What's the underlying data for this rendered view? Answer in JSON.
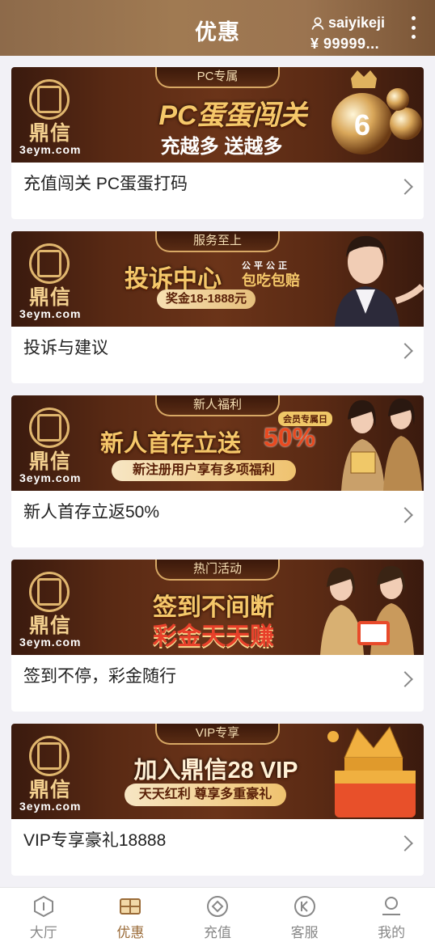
{
  "header": {
    "title": "优惠",
    "username": "saiyikeji",
    "balance": "¥ 99999..."
  },
  "promos": [
    {
      "tab": "PC专属",
      "brand": "鼎信",
      "site": "3eym.com",
      "headline": "PC蛋蛋闯关",
      "sub": "充越多  送越多",
      "label": "充值闯关 PC蛋蛋打码"
    },
    {
      "tab": "服务至上",
      "brand": "鼎信",
      "site": "3eym.com",
      "headline": "投诉中心",
      "side_text_1": "公平公正",
      "side_text_2": "包吃包赔",
      "sub": "奖金18-1888元",
      "label": "投诉与建议"
    },
    {
      "tab": "新人福利",
      "brand": "鼎信",
      "site": "3eym.com",
      "headline": "新人首存立送",
      "badge": "会员专属日",
      "percent": "50%",
      "sub": "新注册用户享有多项福利",
      "label": "新人首存立返50%"
    },
    {
      "tab": "热门活动",
      "brand": "鼎信",
      "site": "3eym.com",
      "headline": "签到不间断",
      "sub": "彩金天天赚",
      "label": "签到不停，彩金随行"
    },
    {
      "tab": "VIP专享",
      "brand": "鼎信",
      "site": "3eym.com",
      "headline": "加入鼎信28 VIP",
      "sub": "天天红利  尊享多重豪礼",
      "label": "VIP专享豪礼18888"
    }
  ],
  "tabbar": [
    {
      "label": "大厅",
      "icon": "lobby-icon"
    },
    {
      "label": "优惠",
      "icon": "promo-icon",
      "active": true
    },
    {
      "label": "充值",
      "icon": "deposit-icon"
    },
    {
      "label": "客服",
      "icon": "support-icon"
    },
    {
      "label": "我的",
      "icon": "profile-icon"
    }
  ],
  "colors": {
    "accent": "#9a6b38",
    "header": "#8d6a4a",
    "gold": "#f5c86a"
  }
}
